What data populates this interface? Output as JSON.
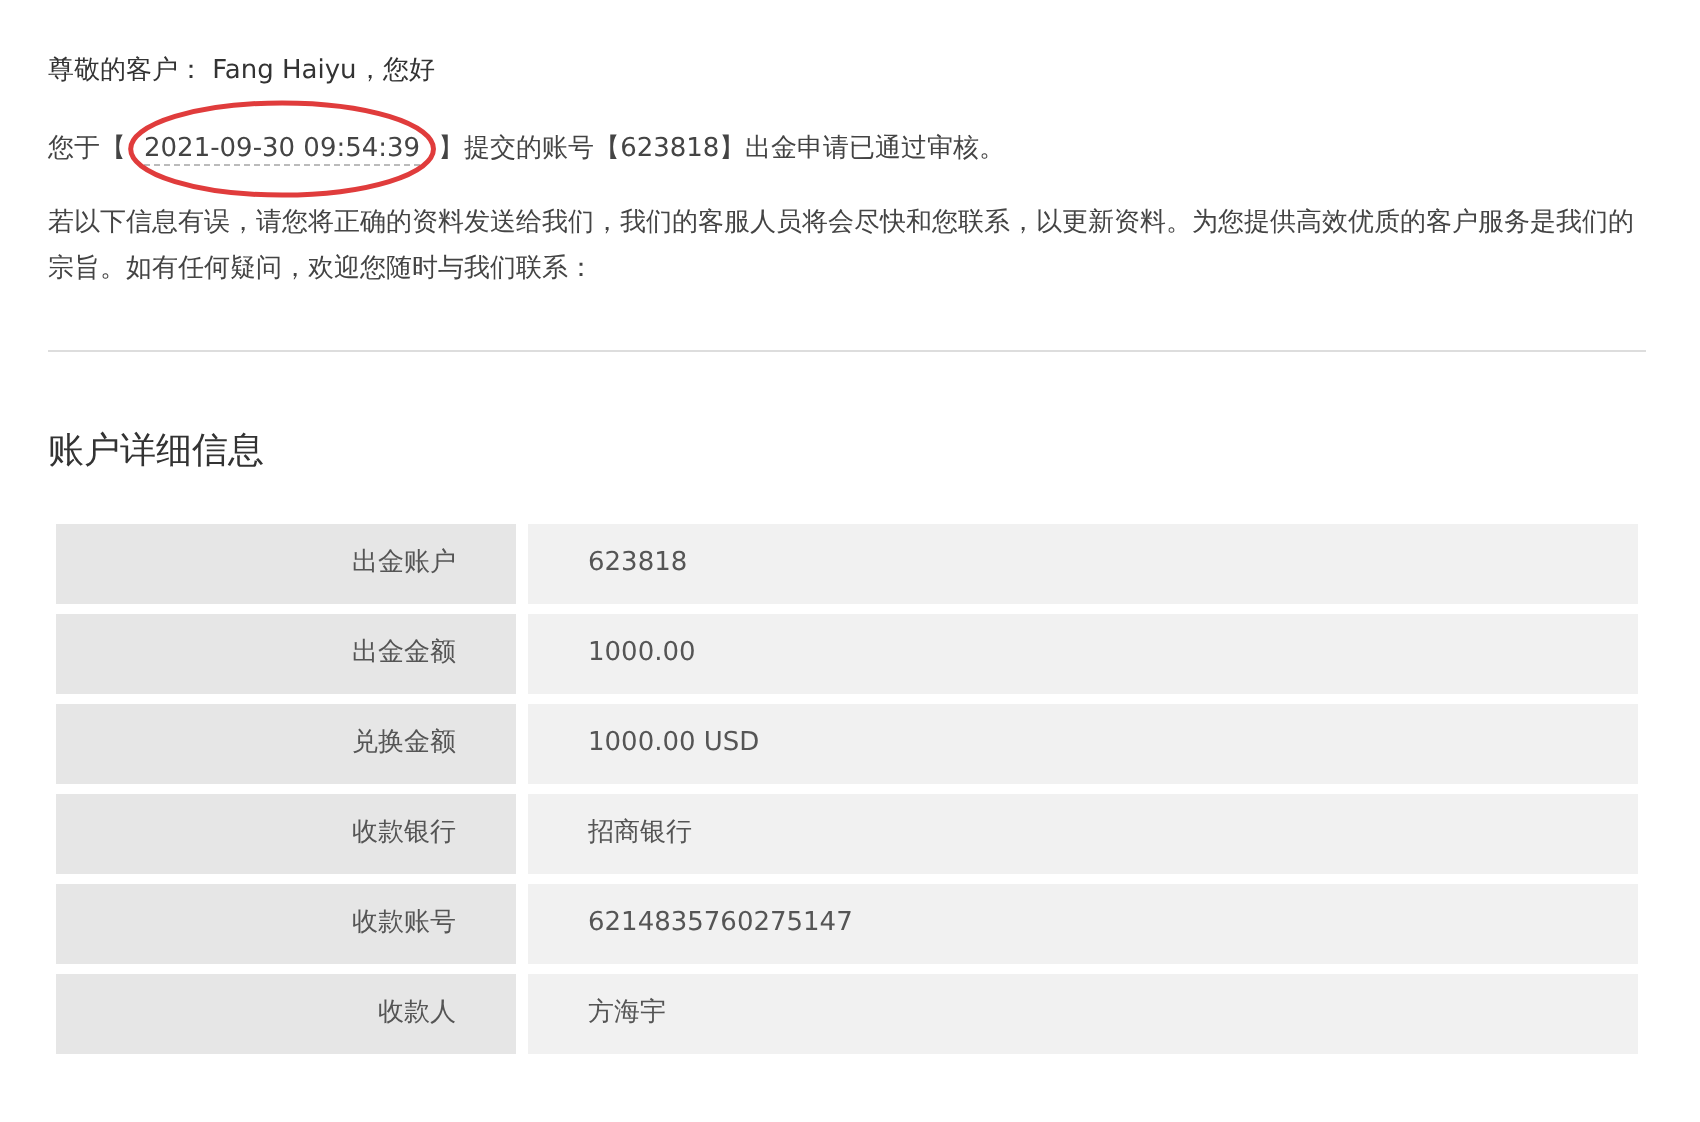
{
  "greeting": "尊敬的客户： Fang Haiyu，您好",
  "notice": {
    "before": "您于【",
    "time": "2021-09-30 09:54:39",
    "after": "】提交的账号【623818】出金申请已通过审核。",
    "time_circled": true
  },
  "paragraph": "若以下信息有误，请您将正确的资料发送给我们，我们的客服人员将会尽快和您联系，以更新资料。为您提供高效优质的客户服务是我们的宗旨。如有任何疑问，欢迎您随时与我们联系：",
  "section_title": "账户详细信息",
  "details": [
    {
      "label": "出金账户",
      "value": "623818"
    },
    {
      "label": "出金金额",
      "value": "1000.00"
    },
    {
      "label": "兑换金额",
      "value": "1000.00 USD"
    },
    {
      "label": "收款银行",
      "value": "招商银行"
    },
    {
      "label": "收款账号",
      "value": "6214835760275147"
    },
    {
      "label": "收款人",
      "value": "方海宇"
    }
  ]
}
